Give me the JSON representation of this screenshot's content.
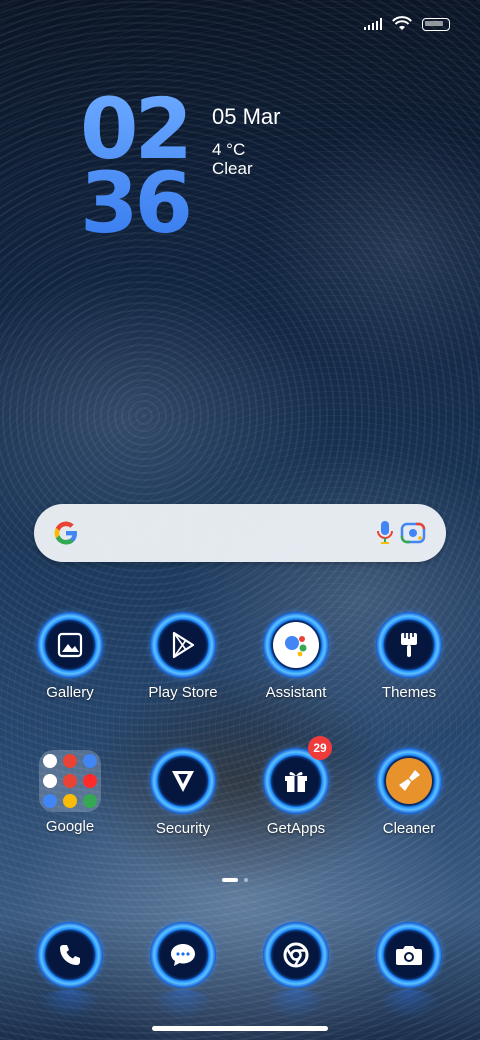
{
  "status_bar": {
    "signal_icon": "signal-bars-icon",
    "wifi_icon": "wifi-icon",
    "battery_icon": "battery-icon"
  },
  "clock": {
    "hours": "02",
    "minutes": "36"
  },
  "date": "05 Mar",
  "weather": {
    "temperature": "4 °C",
    "condition": "Clear"
  },
  "search_bar": {
    "google_icon": "google-g-icon",
    "mic_icon": "microphone-icon",
    "lens_icon": "google-lens-icon"
  },
  "apps_row1": [
    {
      "label": "Gallery",
      "icon": "gallery-icon"
    },
    {
      "label": "Play Store",
      "icon": "play-store-icon"
    },
    {
      "label": "Assistant",
      "icon": "assistant-icon"
    },
    {
      "label": "Themes",
      "icon": "themes-brush-icon"
    }
  ],
  "apps_row2": [
    {
      "label": "Google",
      "icon": "folder-icon"
    },
    {
      "label": "Security",
      "icon": "security-icon"
    },
    {
      "label": "GetApps",
      "icon": "gift-icon",
      "badge": "29"
    },
    {
      "label": "Cleaner",
      "icon": "cleaner-broom-icon"
    }
  ],
  "dock": [
    {
      "icon": "phone-icon"
    },
    {
      "icon": "messages-icon"
    },
    {
      "icon": "chrome-icon"
    },
    {
      "icon": "camera-icon"
    }
  ],
  "colors": {
    "clock": "#4d94ff",
    "badge": "#ef3b3b",
    "ring": "#1e8dff"
  }
}
